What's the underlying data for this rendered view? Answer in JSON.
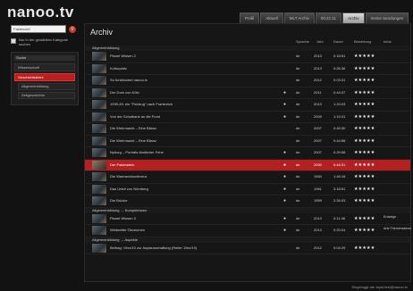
{
  "app": {
    "logo": "nanoo.tv"
  },
  "tabs": [
    {
      "label": "Profil",
      "active": false
    },
    {
      "label": "Aktuell",
      "active": false
    },
    {
      "label": "MLT Archiv",
      "active": false
    },
    {
      "label": "00:21:11",
      "active": false
    },
    {
      "label": "Archiv",
      "active": true
    },
    {
      "label": "meine Sendungen",
      "active": false
    }
  ],
  "sidebar": {
    "search_value": "Faktendeil",
    "search_icon": "search-icon",
    "checkbox_label": "Nur in der gewählten Kategorie suchen",
    "section_title": "Suche",
    "items": [
      {
        "label": "Wissenschaft",
        "active": false,
        "sub": false
      },
      {
        "label": "Geschichtslehre",
        "active": true,
        "sub": false
      },
      {
        "label": "Allgemeinbildung",
        "active": false,
        "sub": true
      },
      {
        "label": "Zeitgeschichte",
        "active": false,
        "sub": true
      }
    ]
  },
  "main": {
    "title": "Archiv",
    "columns": {
      "title": "",
      "lang": "Sprache",
      "year": "Jahr",
      "duration": "Dauer",
      "rating": "Bewertung",
      "info": "Infos"
    },
    "groups": [
      {
        "label": "Allgemeinbildung",
        "rows": [
          {
            "title": "Planet Wissen 2",
            "dot": "",
            "lang": "de",
            "year": "2013",
            "duration": "0:18:51",
            "rating": "★★★★★",
            "info": "",
            "highlight": false
          },
          {
            "title": "Kulturplatz",
            "dot": "",
            "lang": "de",
            "year": "2013",
            "duration": "0:26:36",
            "rating": "★★★★★",
            "info": "",
            "highlight": false
          },
          {
            "title": "So funktioniert nanoo.tv",
            "dot": "",
            "lang": "de",
            "year": "2012",
            "duration": "0:03:31",
            "rating": "★★★★★",
            "info": "",
            "highlight": false
          },
          {
            "title": "Der Dom von Köln",
            "dot": "●",
            "lang": "de",
            "year": "2011",
            "duration": "0:44:37",
            "rating": "★★★★★",
            "info": "",
            "highlight": false
          },
          {
            "title": "1939-45: ein \"Feldzug\" nach Frankreich",
            "dot": "●",
            "lang": "de",
            "year": "2013",
            "duration": "1:24:03",
            "rating": "★★★★★",
            "info": "",
            "highlight": false
          },
          {
            "title": "Von der Schulbank an die Front",
            "dot": "●",
            "lang": "de",
            "year": "2009",
            "duration": "1:19:31",
            "rating": "★★★★★",
            "info": "",
            "highlight": false
          },
          {
            "title": "Die Wehrmacht – Eine Bilanz",
            "dot": "",
            "lang": "de",
            "year": "2007",
            "duration": "0:45:30",
            "rating": "★★★★★",
            "info": "",
            "highlight": false
          },
          {
            "title": "Die Wehrmacht – Eine Bilanz",
            "dot": "",
            "lang": "de",
            "year": "2007",
            "duration": "0:44:58",
            "rating": "★★★★★",
            "info": "",
            "highlight": false
          },
          {
            "title": "Nyborg – Porträts ländlicher Fehe",
            "dot": "●",
            "lang": "de",
            "year": "2007",
            "duration": "0:29:58",
            "rating": "★★★★★",
            "info": "",
            "highlight": false
          },
          {
            "title": "Der Pakenstein",
            "dot": "●",
            "lang": "de",
            "year": "2000",
            "duration": "0:44:31",
            "rating": "★★★★★",
            "info": "",
            "highlight": true
          },
          {
            "title": "Die Wannseekonferenz",
            "dot": "●",
            "lang": "de",
            "year": "1984",
            "duration": "1:46:18",
            "rating": "★★★★★",
            "info": "",
            "highlight": false
          },
          {
            "title": "Das Urteil von Nürnberg",
            "dot": "●",
            "lang": "de",
            "year": "1961",
            "duration": "3:18:51",
            "rating": "★★★★★",
            "info": "",
            "highlight": false
          },
          {
            "title": "Die Brücke",
            "dot": "●",
            "lang": "de",
            "year": "1959",
            "duration": "2:26:03",
            "rating": "★★★★★",
            "info": "",
            "highlight": false
          }
        ]
      },
      {
        "label": "Allgemeinbildung → Kompetenzen",
        "rows": [
          {
            "title": "Planet Wissen 3",
            "dot": "●",
            "lang": "de",
            "year": "2013",
            "duration": "0:11:46",
            "rating": "★★★★★",
            "info": "Erdzeige",
            "highlight": false
          },
          {
            "title": "Weltweitte Ökonomen",
            "dot": "●",
            "lang": "de",
            "year": "2013",
            "duration": "0:20:04",
            "rating": "★★★★★",
            "info": "Arte Themenabend",
            "highlight": false
          }
        ]
      },
      {
        "label": "Allgemeinbildung → Aspekte",
        "rows": [
          {
            "title": "Beitrag: 19xx/10 zur Asylausschaffung (Reiter 19xx/10)",
            "dot": "",
            "lang": "de",
            "year": "2012",
            "duration": "0:04:29",
            "rating": "★★★★★",
            "info": "",
            "highlight": false
          }
        ]
      }
    ]
  },
  "footer": {
    "text": "Eingeloggt als: tsyst.test@nanoo.tv"
  },
  "colors": {
    "accent": "#b51f1f",
    "background": "#121212",
    "panel": "#161616"
  }
}
